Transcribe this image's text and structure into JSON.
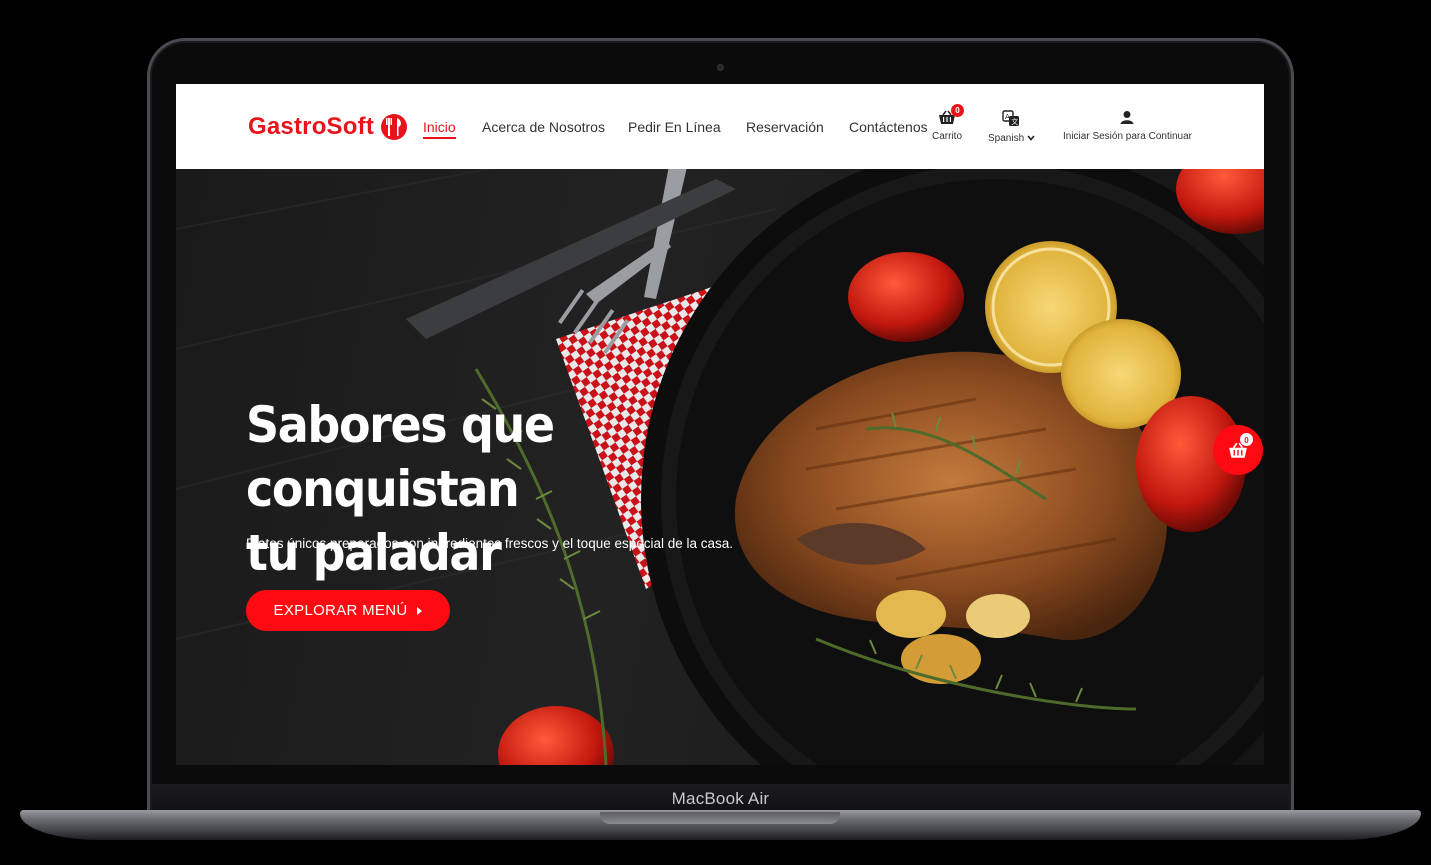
{
  "device": {
    "model_label": "MacBook Air"
  },
  "brand": {
    "name": "GastroSoft",
    "accent": "#e8141c"
  },
  "nav": {
    "links": [
      {
        "label": "Inicio",
        "active": true
      },
      {
        "label": "Acerca de Nosotros"
      },
      {
        "label": "Pedir En Línea"
      },
      {
        "label": "Reservación"
      },
      {
        "label": "Contáctenos"
      }
    ],
    "cart": {
      "label": "Carrito",
      "count": "0",
      "icon": "cart-icon"
    },
    "language": {
      "label": "Spanish",
      "icon": "translate-icon"
    },
    "login": {
      "label": "Iniciar Sesión para Continuar",
      "icon": "user-icon"
    }
  },
  "hero": {
    "title_line1": "Sabores que conquistan",
    "title_line2": "tu paladar",
    "subtitle": "Platos únicos preparados con ingredientes frescos y el toque especial de la casa.",
    "cta_label": "EXPLORAR MENÚ",
    "floating_cart_count": "0"
  }
}
